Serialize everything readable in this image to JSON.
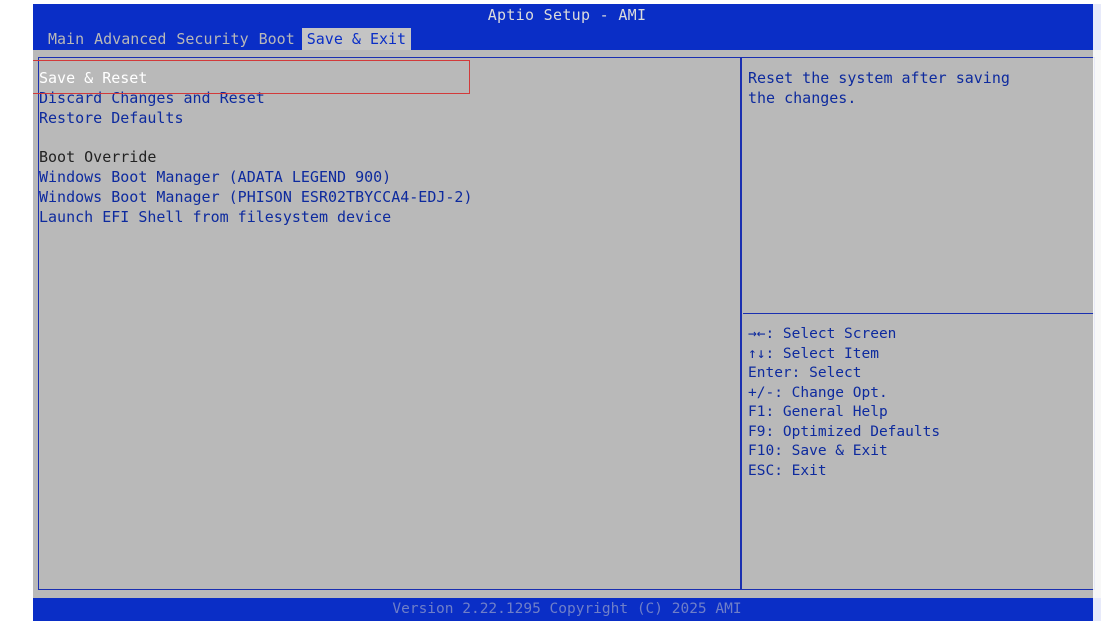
{
  "header": {
    "title": "Aptio Setup - AMI",
    "tabs": [
      {
        "label": "Main",
        "active": false
      },
      {
        "label": "Advanced",
        "active": false
      },
      {
        "label": "Security",
        "active": false
      },
      {
        "label": "Boot",
        "active": false
      },
      {
        "label": "Save & Exit",
        "active": true
      }
    ]
  },
  "menu": {
    "items": [
      {
        "label": "Save & Reset",
        "selected": true
      },
      {
        "label": "Discard Changes and Reset"
      },
      {
        "label": "Restore Defaults"
      }
    ],
    "section_label": "Boot Override",
    "boot_items": [
      {
        "label": "Windows Boot Manager (ADATA LEGEND 900)"
      },
      {
        "label": "Windows Boot Manager (PHISON ESR02TBYCCA4-EDJ-2)"
      },
      {
        "label": "Launch EFI Shell from filesystem device"
      }
    ]
  },
  "help": {
    "text_line1": "Reset the system after saving",
    "text_line2": "the changes."
  },
  "keys": [
    {
      "text": "→←: Select Screen"
    },
    {
      "text": "↑↓: Select Item"
    },
    {
      "text": "Enter: Select"
    },
    {
      "text": "+/-: Change Opt."
    },
    {
      "text": "F1: General Help"
    },
    {
      "text": "F9: Optimized Defaults"
    },
    {
      "text": "F10: Save & Exit"
    },
    {
      "text": "ESC: Exit"
    }
  ],
  "footer": {
    "text": "Version 2.22.1295 Copyright (C) 2025 AMI"
  },
  "colors": {
    "bar_blue": "#0a2ec6",
    "panel_gray": "#b9b9b9",
    "item_blue": "#0d2a9e",
    "highlight_red": "#d23a3a"
  }
}
